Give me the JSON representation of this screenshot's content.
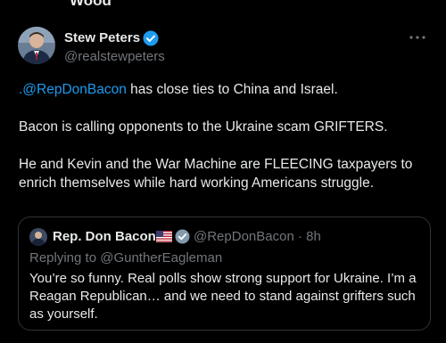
{
  "prev_fragment": "Wood",
  "tweet": {
    "author_name": "Stew Peters",
    "author_handle": "@realstewpeters",
    "mention": ".@RepDonBacon",
    "line1_rest": " has close ties to China and Israel.",
    "line2": "Bacon is calling opponents to the Ukraine scam GRIFTERS.",
    "line3": "He and Kevin and the War Machine are FLEECING taxpayers to enrich themselves while hard working Americans struggle."
  },
  "quote": {
    "author_name": "Rep. Don Bacon",
    "handle_time": "@RepDonBacon · 8h",
    "replying_to": "Replying to @GuntherEagleman",
    "text": "You’re so funny. Real polls show strong  support for Ukraine. I’m a Reagan Republican… and we need to stand against grifters such as yourself."
  },
  "colors": {
    "background": "#000000",
    "text": "#e7e9ea",
    "secondary": "#71767b",
    "accent": "#1d9bf0",
    "border": "#2f3336"
  },
  "icons": {
    "verified": "verified-badge-icon",
    "government_verified": "gray-verified-badge-icon",
    "more": "more-horizontal-icon",
    "flag": "us-flag-icon"
  }
}
